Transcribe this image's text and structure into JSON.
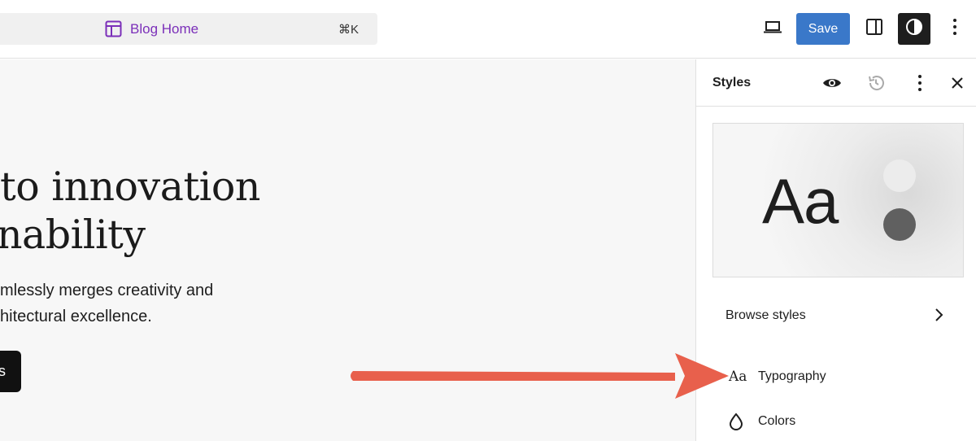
{
  "topbar": {
    "document_title": "Blog Home",
    "shortcut": "⌘K",
    "save_label": "Save"
  },
  "canvas": {
    "hero_lines": [
      "to innovation",
      "nability"
    ],
    "paragraph_lines": [
      "mlessly merges creativity and",
      "hitectural excellence."
    ],
    "cta_label": "s"
  },
  "sidebar": {
    "title": "Styles",
    "preview_text": "Aa",
    "browse_label": "Browse styles",
    "typography_icon_text": "Aa",
    "typography_label": "Typography",
    "colors_label": "Colors"
  },
  "colors": {
    "accent": "#3a78c9",
    "template_link": "#7b2fb9",
    "annotation_arrow": "#e8604c"
  },
  "icons": [
    "template-icon",
    "desktop-device-icon",
    "sidebar-panel-icon",
    "contrast-icon",
    "more-vertical-icon",
    "eye-icon",
    "history-icon",
    "close-icon",
    "chevron-right-icon",
    "typography-icon",
    "droplet-icon"
  ]
}
